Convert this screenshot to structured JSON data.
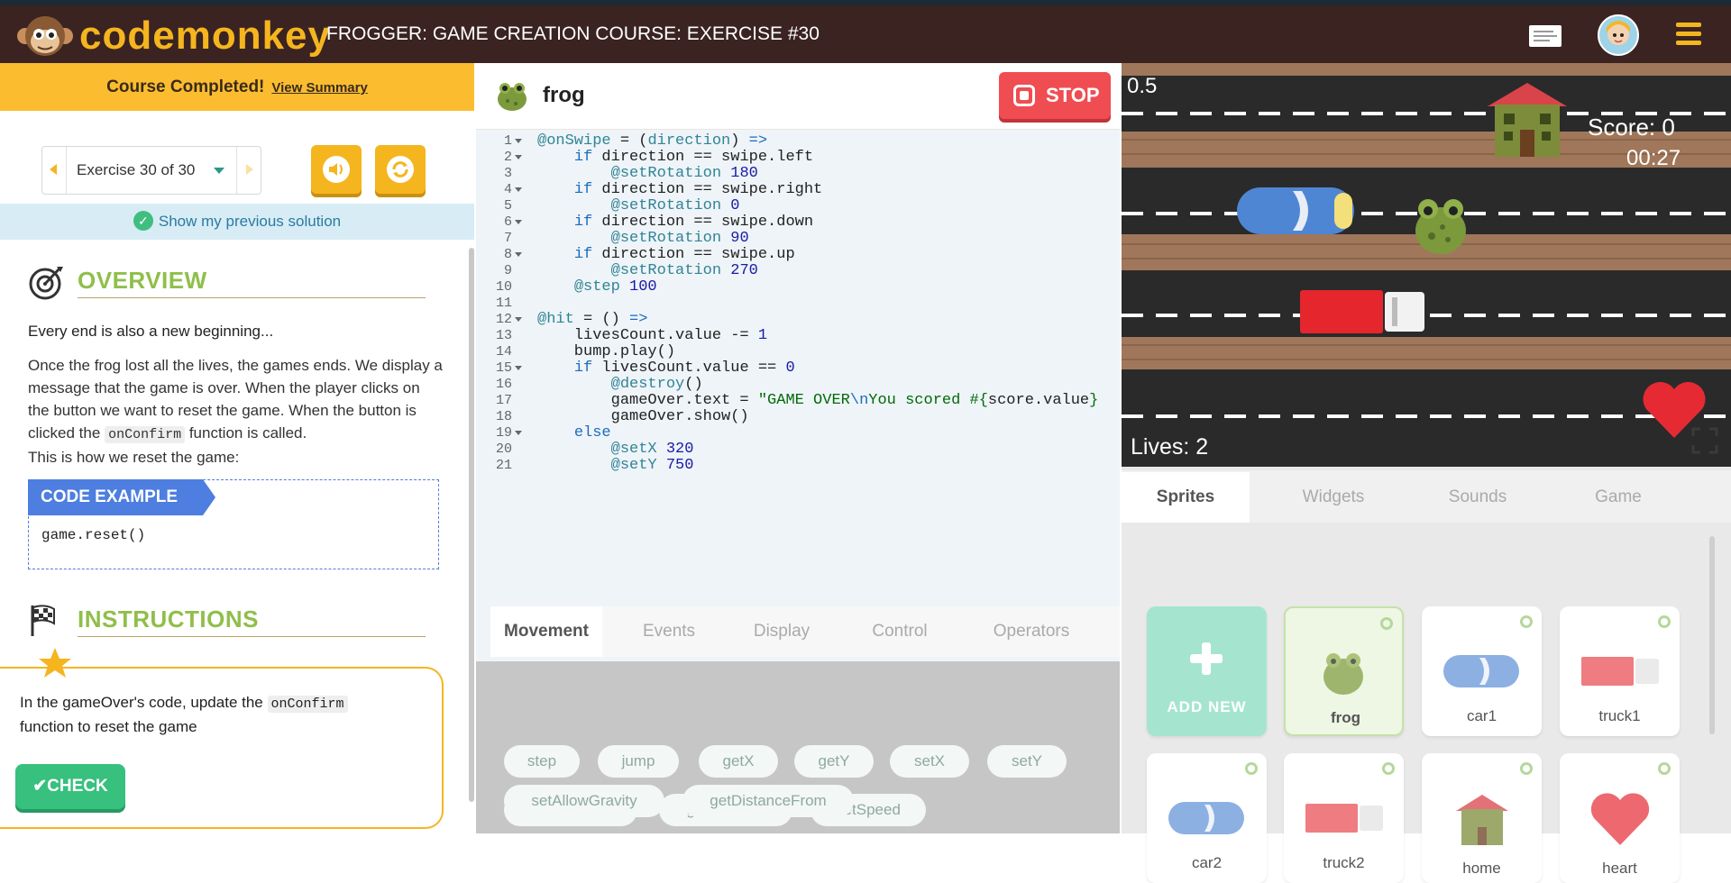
{
  "header": {
    "logo_text": "codemonkey",
    "title": "FROGGER: GAME CREATION COURSE: EXERCISE #30",
    "icons": [
      "notes-icon",
      "user-avatar",
      "hamburger-menu-icon"
    ]
  },
  "left": {
    "banner_text": "Course Completed!",
    "banner_link": "View Summary",
    "exercise_select": "Exercise 30 of 30",
    "show_prev": "Show my previous solution",
    "overview_title": "OVERVIEW",
    "overview_subtitle": "Every end is also a new beginning...",
    "overview_p1": "Once the frog lost all the lives, the games ends. We display a message that the game is over. When the player clicks on the button we want to reset the game. When the button is clicked the",
    "overview_code": "onConfirm",
    "overview_p2": "function is called.",
    "overview_p3": "This is how we reset the game:",
    "code_example_label": "CODE EXAMPLE",
    "code_example": "game.reset()",
    "instructions_title": "INSTRUCTIONS",
    "instr_p1": "In the gameOver's code, update the",
    "instr_code": "onConfirm",
    "instr_p2": "function to reset the game",
    "check_label": "✔CHECK"
  },
  "editor": {
    "sprite_name": "frog",
    "stop_label": "STOP",
    "line_numbers": [
      "1",
      "2",
      "3",
      "4",
      "5",
      "6",
      "7",
      "8",
      "9",
      "10",
      "11",
      "12",
      "13",
      "14",
      "15",
      "16",
      "17",
      "18",
      "19",
      "20",
      "21"
    ],
    "tabs": [
      "Movement",
      "Events",
      "Display",
      "Control",
      "Operators"
    ],
    "chips": [
      "step",
      "jump",
      "getX",
      "getY",
      "setX",
      "setY",
      "setRotation",
      "getRotation",
      "setSpeed",
      "setAllowGravity",
      "getDistanceFrom"
    ]
  },
  "game": {
    "speed": "0.5",
    "score_label": "Score:  0",
    "timer": "00:27",
    "lives_label": "Lives:  2"
  },
  "right": {
    "tabs": [
      "Sprites",
      "Widgets",
      "Sounds",
      "Game"
    ],
    "add_new": "ADD NEW",
    "sprites": [
      "frog",
      "car1",
      "truck1",
      "car2",
      "truck2",
      "home",
      "heart"
    ]
  },
  "colors": {
    "brand_yellow": "#f5b51f",
    "header_brown": "#3a2321",
    "stop_red": "#ef4d52",
    "check_green": "#37c07e"
  }
}
